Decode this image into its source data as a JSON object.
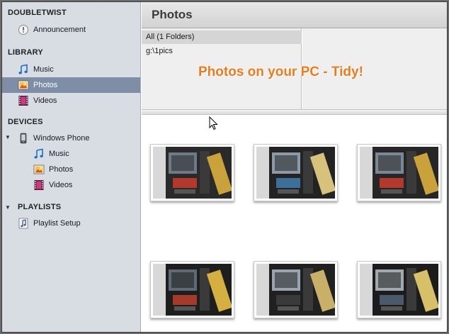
{
  "sidebar": {
    "sections": {
      "doubletwist": "DOUBLETWIST",
      "library": "LIBRARY",
      "devices": "DEVICES",
      "playlists": "PLAYLISTS"
    },
    "announcement": "Announcement",
    "library_items": {
      "music": "Music",
      "photos": "Photos",
      "videos": "Videos"
    },
    "device_name": "Windows Phone",
    "device_items": {
      "music": "Music",
      "photos": "Photos",
      "videos": "Videos"
    },
    "playlist_setup": "Playlist Setup",
    "selected": "library.photos"
  },
  "main": {
    "title": "Photos",
    "folders": {
      "all": "All (1 Folders)",
      "path": "g:\\1pics"
    },
    "overlay_text": "Photos on your PC - Tidy!",
    "thumbnail_count": 6
  },
  "colors": {
    "sidebar_bg": "#d8dde4",
    "selection": "#7e8ea6",
    "overlay_text": "#f07a18"
  },
  "icons": {
    "announcement": "exclamation-circle-icon",
    "music": "music-note-icon",
    "photos": "photo-icon",
    "videos": "film-strip-icon",
    "device": "phone-icon",
    "playlist": "playlist-icon",
    "expand": "triangle-down-icon"
  }
}
